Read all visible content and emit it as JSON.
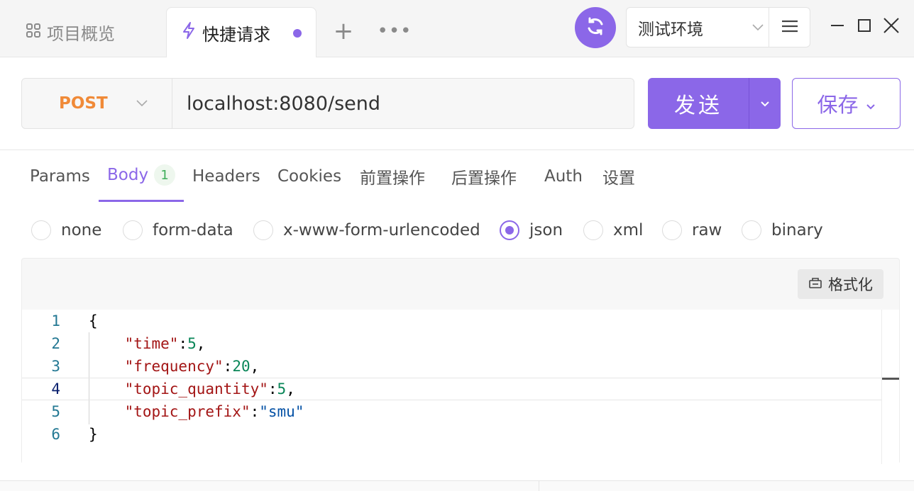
{
  "tabs": {
    "overview_label": "项目概览",
    "active_label": "快捷请求",
    "add_label": "+",
    "more_label": "•••"
  },
  "environment": {
    "selected": "测试环境"
  },
  "request": {
    "method": "POST",
    "url": "localhost:8080/send",
    "send_label": "发送",
    "save_label": "保存"
  },
  "subtabs": {
    "params": "Params",
    "body": "Body",
    "body_badge": "1",
    "headers": "Headers",
    "cookies": "Cookies",
    "pre_ops": "前置操作",
    "post_ops": "后置操作",
    "auth": "Auth",
    "settings": "设置"
  },
  "body_types": {
    "none": "none",
    "form_data": "form-data",
    "urlencoded": "x-www-form-urlencoded",
    "json": "json",
    "xml": "xml",
    "raw": "raw",
    "binary": "binary",
    "selected": "json"
  },
  "editor": {
    "format_label": "格式化",
    "line_numbers": [
      "1",
      "2",
      "3",
      "4",
      "5",
      "6"
    ],
    "open_brace": "{",
    "close_brace": "}",
    "fields": [
      {
        "key": "\"time\"",
        "value": "5",
        "tail": ","
      },
      {
        "key": "\"frequency\"",
        "value": "20",
        "tail": ","
      },
      {
        "key": "\"topic_quantity\"",
        "value": "5",
        "tail": ","
      },
      {
        "key": "\"topic_prefix\"",
        "value": "\"smu\"",
        "tail": ""
      }
    ],
    "current_line": "4"
  },
  "colors": {
    "accent": "#8b67e8",
    "method": "#f08a38",
    "badge_text": "#3fae5a"
  }
}
